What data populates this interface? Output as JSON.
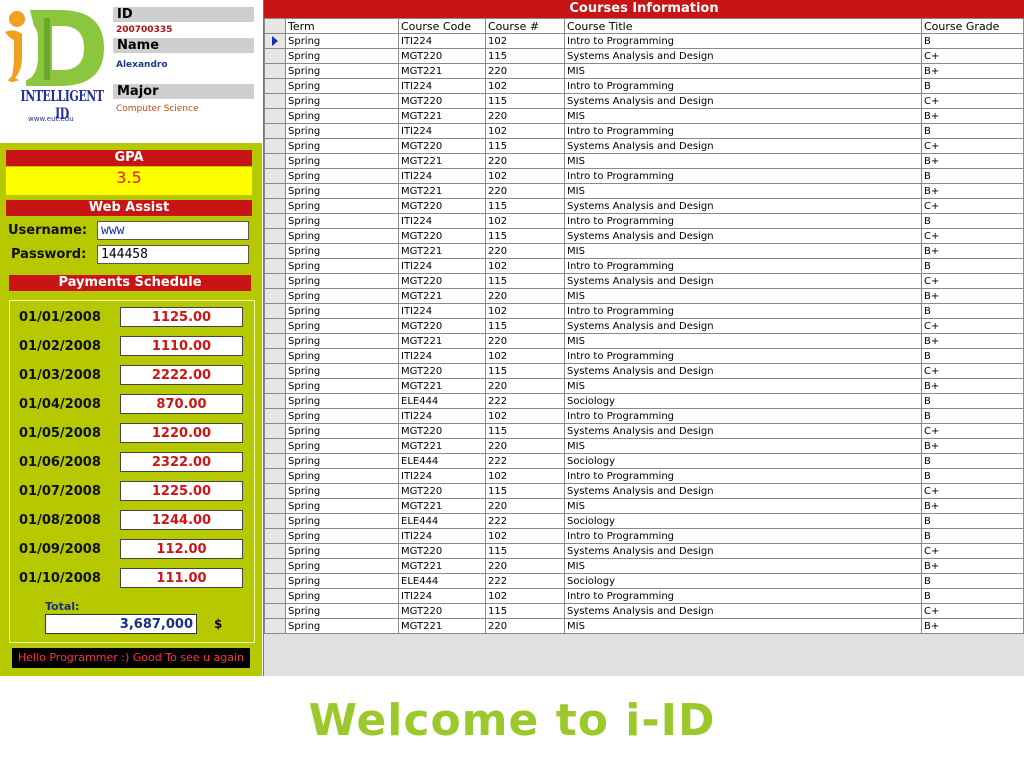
{
  "logo": {
    "main": "iD",
    "subtitle": "INTELLIGENT ID",
    "website": "www.eut.edu"
  },
  "student": {
    "id_label": "ID",
    "id_value": "200700335",
    "name_label": "Name",
    "name_value": "Alexandro",
    "major_label": "Major",
    "major_value": "Computer Science"
  },
  "gpa": {
    "label": "GPA",
    "value": "3.5"
  },
  "web_assist": {
    "title": "Web Assist",
    "username_label": "Username:",
    "username_value": "www",
    "password_label": "Password:",
    "password_value": "144458"
  },
  "payments": {
    "title": "Payments Schedule",
    "items": [
      {
        "date": "01/01/2008",
        "amount": "1125.00"
      },
      {
        "date": "01/02/2008",
        "amount": "1110.00"
      },
      {
        "date": "01/03/2008",
        "amount": "2222.00"
      },
      {
        "date": "01/04/2008",
        "amount": "870.00"
      },
      {
        "date": "01/05/2008",
        "amount": "1220.00"
      },
      {
        "date": "01/06/2008",
        "amount": "2322.00"
      },
      {
        "date": "01/07/2008",
        "amount": "1225.00"
      },
      {
        "date": "01/08/2008",
        "amount": "1244.00"
      },
      {
        "date": "01/09/2008",
        "amount": "112.00"
      },
      {
        "date": "01/10/2008",
        "amount": "111.00"
      }
    ],
    "total_label": "Total:",
    "total_value": "3,687,000",
    "currency": "$"
  },
  "message": "Hello Programmer :) Good To see u again",
  "courses": {
    "title": "Courses Information",
    "columns": [
      "Term",
      "Course Code",
      "Course #",
      "Course Title",
      "Course Grade"
    ],
    "rows": [
      [
        "Spring",
        "ITI224",
        "102",
        "Intro to Programming",
        "B"
      ],
      [
        "Spring",
        "MGT220",
        "115",
        "Systems Analysis and Design",
        "C+"
      ],
      [
        "Spring",
        "MGT221",
        "220",
        "MIS",
        "B+"
      ],
      [
        "Spring",
        "ITI224",
        "102",
        "Intro to Programming",
        "B"
      ],
      [
        "Spring",
        "MGT220",
        "115",
        "Systems Analysis and Design",
        "C+"
      ],
      [
        "Spring",
        "MGT221",
        "220",
        "MIS",
        "B+"
      ],
      [
        "Spring",
        "ITI224",
        "102",
        "Intro to Programming",
        "B"
      ],
      [
        "Spring",
        "MGT220",
        "115",
        "Systems Analysis and Design",
        "C+"
      ],
      [
        "Spring",
        "MGT221",
        "220",
        "MIS",
        "B+"
      ],
      [
        "Spring",
        "ITI224",
        "102",
        "Intro to Programming",
        "B"
      ],
      [
        "Spring",
        "MGT221",
        "220",
        "MIS",
        "B+"
      ],
      [
        "Spring",
        "MGT220",
        "115",
        "Systems Analysis and Design",
        "C+"
      ],
      [
        "Spring",
        "ITI224",
        "102",
        "Intro to Programming",
        "B"
      ],
      [
        "Spring",
        "MGT220",
        "115",
        "Systems Analysis and Design",
        "C+"
      ],
      [
        "Spring",
        "MGT221",
        "220",
        "MIS",
        "B+"
      ],
      [
        "Spring",
        "ITI224",
        "102",
        "Intro to Programming",
        "B"
      ],
      [
        "Spring",
        "MGT220",
        "115",
        "Systems Analysis and Design",
        "C+"
      ],
      [
        "Spring",
        "MGT221",
        "220",
        "MIS",
        "B+"
      ],
      [
        "Spring",
        "ITI224",
        "102",
        "Intro to Programming",
        "B"
      ],
      [
        "Spring",
        "MGT220",
        "115",
        "Systems Analysis and Design",
        "C+"
      ],
      [
        "Spring",
        "MGT221",
        "220",
        "MIS",
        "B+"
      ],
      [
        "Spring",
        "ITI224",
        "102",
        "Intro to Programming",
        "B"
      ],
      [
        "Spring",
        "MGT220",
        "115",
        "Systems Analysis and Design",
        "C+"
      ],
      [
        "Spring",
        "MGT221",
        "220",
        "MIS",
        "B+"
      ],
      [
        "Spring",
        "ELE444",
        "222",
        "Sociology",
        "B"
      ],
      [
        "Spring",
        "ITI224",
        "102",
        "Intro to Programming",
        "B"
      ],
      [
        "Spring",
        "MGT220",
        "115",
        "Systems Analysis and Design",
        "C+"
      ],
      [
        "Spring",
        "MGT221",
        "220",
        "MIS",
        "B+"
      ],
      [
        "Spring",
        "ELE444",
        "222",
        "Sociology",
        "B"
      ],
      [
        "Spring",
        "ITI224",
        "102",
        "Intro to Programming",
        "B"
      ],
      [
        "Spring",
        "MGT220",
        "115",
        "Systems Analysis and Design",
        "C+"
      ],
      [
        "Spring",
        "MGT221",
        "220",
        "MIS",
        "B+"
      ],
      [
        "Spring",
        "ELE444",
        "222",
        "Sociology",
        "B"
      ],
      [
        "Spring",
        "ITI224",
        "102",
        "Intro to Programming",
        "B"
      ],
      [
        "Spring",
        "MGT220",
        "115",
        "Systems Analysis and Design",
        "C+"
      ],
      [
        "Spring",
        "MGT221",
        "220",
        "MIS",
        "B+"
      ],
      [
        "Spring",
        "ELE444",
        "222",
        "Sociology",
        "B"
      ],
      [
        "Spring",
        "ITI224",
        "102",
        "Intro to Programming",
        "B"
      ],
      [
        "Spring",
        "MGT220",
        "115",
        "Systems Analysis and Design",
        "C+"
      ],
      [
        "Spring",
        "MGT221",
        "220",
        "MIS",
        "B+"
      ]
    ]
  },
  "welcome": "Welcome to i-ID",
  "colors": {
    "accent_red": "#c81414",
    "panel_green": "#b5c800",
    "gpa_yellow": "#ffff00",
    "welcome_green": "#9bc82b",
    "logo_orange": "#f0a01e"
  }
}
